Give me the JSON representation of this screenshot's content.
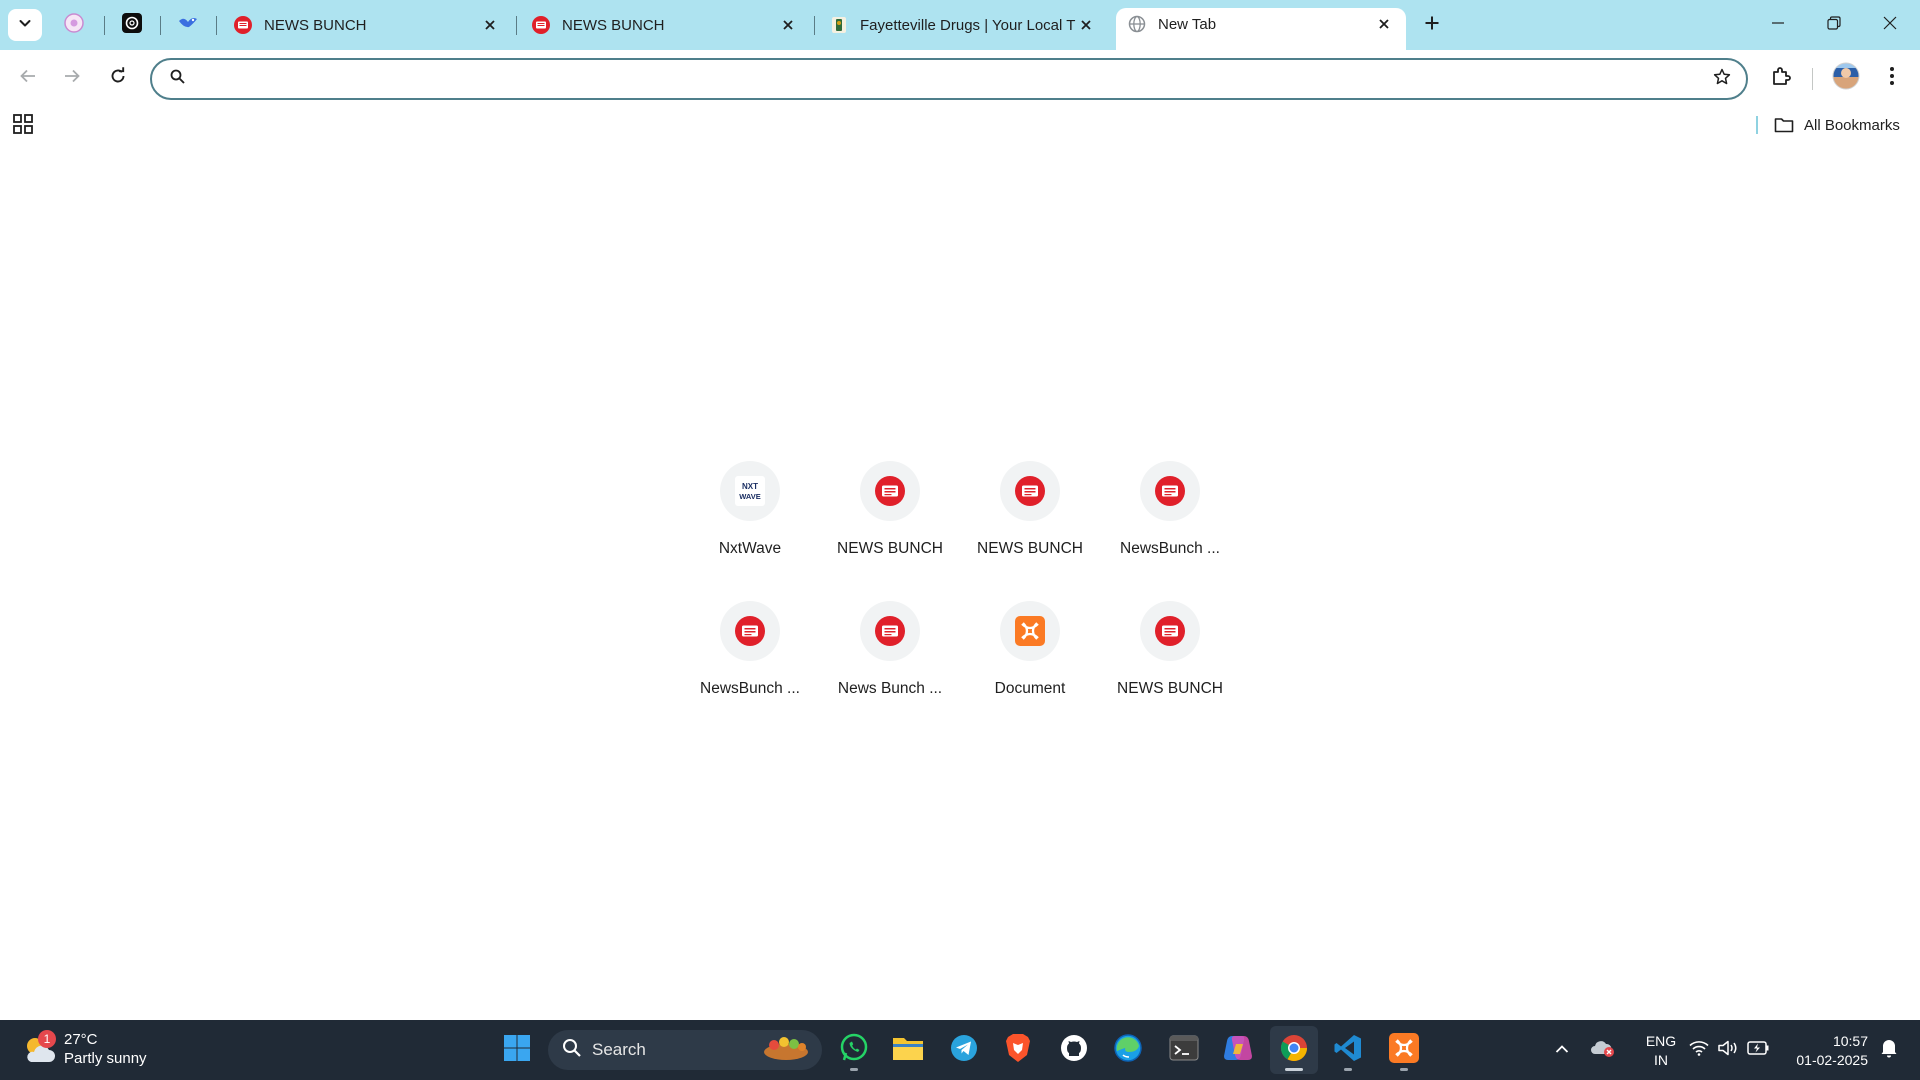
{
  "browser": {
    "tabs": [
      {
        "title": "NEWS BUNCH"
      },
      {
        "title": "NEWS BUNCH"
      },
      {
        "title": "Fayetteville Drugs | Your Local T"
      },
      {
        "title": "New Tab"
      }
    ],
    "omnibox": {
      "value": "",
      "placeholder": ""
    },
    "bookmarks": {
      "all_label": "All Bookmarks"
    },
    "colors": {
      "tabstrip": "#aee3f0",
      "omnibox_border": "#4f7f8b",
      "newsbunch_red": "#e0202a"
    }
  },
  "shortcuts": [
    {
      "label": "NxtWave",
      "icon": "nxtwave-icon"
    },
    {
      "label": "NEWS BUNCH",
      "icon": "newsbunch-icon"
    },
    {
      "label": "NEWS BUNCH",
      "icon": "newsbunch-icon"
    },
    {
      "label": "NewsBunch ...",
      "icon": "newsbunch-icon"
    },
    {
      "label": "NewsBunch ...",
      "icon": "newsbunch-icon"
    },
    {
      "label": "News Bunch ...",
      "icon": "newsbunch-icon"
    },
    {
      "label": "Document",
      "icon": "xampp-icon"
    },
    {
      "label": "NEWS BUNCH",
      "icon": "newsbunch-icon"
    }
  ],
  "taskbar": {
    "weather": {
      "temp": "27°C",
      "condition": "Partly sunny",
      "badge": "1"
    },
    "search_label": "Search",
    "language": {
      "line1": "ENG",
      "line2": "IN"
    },
    "clock": {
      "time": "10:57",
      "date": "01-02-2025"
    }
  }
}
